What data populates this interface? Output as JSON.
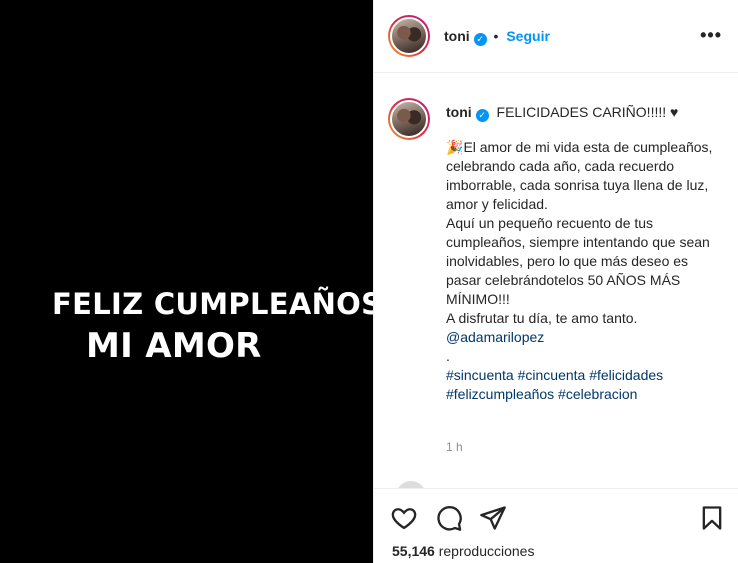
{
  "media": {
    "line1": "FELIZ CUMPLEAÑOS",
    "line2": "MI AMOR"
  },
  "header": {
    "username": "toni",
    "verified_icon": "verified-badge-icon",
    "separator": "•",
    "follow_label": "Seguir",
    "more_icon": "•••"
  },
  "caption": {
    "username": "toni",
    "headline": "FELICIDADES CARIÑO!!!!! ♥",
    "party_icon": "🎉",
    "lines": [
      "El amor de mi vida esta de cumpleaños, celebrando cada año, cada recuerdo imborrable, cada sonrisa tuya llena de luz, amor y felicidad.",
      "Aquí un pequeño recuento de tus cumpleaños, siempre intentando que sean inolvidables, pero lo que más deseo es pasar celebrándotelos 50 AÑOS MÁS MÍNIMO!!!",
      "A disfrutar tu día, te amo tanto."
    ],
    "mention": "@adamarilopez",
    "dot": ".",
    "hashtags_line1": "#sincuenta #cincuenta #felicidades",
    "hashtags_line2": "#felizcumpleaños #celebracion",
    "time": "1 h"
  },
  "actions": {
    "views_count": "55,146",
    "views_label": "reproducciones"
  },
  "colors": {
    "accent": "#0095f6",
    "link": "#00376b",
    "media_bg": "#000000"
  }
}
